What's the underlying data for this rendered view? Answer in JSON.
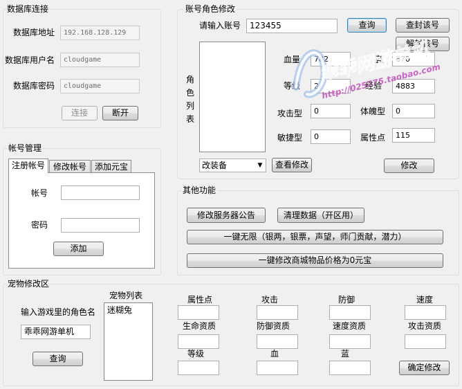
{
  "db": {
    "title": "数据库连接",
    "address_label": "数据库地址",
    "address_value": "192.168.128.129",
    "user_label": "数据库用户名",
    "user_value": "cloudgame",
    "password_label": "数据库密码",
    "password_value": "cloudgame",
    "connect_label": "连接",
    "disconnect_label": "断开"
  },
  "account": {
    "title": "帐号管理",
    "tabs": [
      "注册帐号",
      "修改帐号",
      "添加元宝"
    ],
    "account_label": "帐号",
    "password_label": "密码",
    "add_label": "添加"
  },
  "role": {
    "title": "账号角色修改",
    "input_label": "请输入账号",
    "input_value": "123455",
    "query_label": "查询",
    "ban_label": "查封该号",
    "unban_label": "解封该号",
    "list_label": "角色列表",
    "hp_label": "血量",
    "hp_value": "782",
    "mp_label": "蓝",
    "mp_value": "870",
    "level_label": "等级",
    "level_value": "2",
    "exp_label": "经验",
    "exp_value": "4883",
    "attack_label": "攻击型",
    "attack_value": "0",
    "physique_label": "体魄型",
    "physique_value": "0",
    "agility_label": "敏捷型",
    "agility_value": "0",
    "attr_label": "属性点",
    "attr_value": "115",
    "equip_select": "改装备",
    "view_label": "查看修改",
    "modify_label": "修改"
  },
  "other": {
    "title": "其他功能",
    "notice_label": "修改服务器公告",
    "clean_label": "清理数据（开区用）",
    "unlimited_label": "一键无限（银两，银票，声望，师门贡献，潜力）",
    "mall_label": "一键修改商城物品价格为0元宝"
  },
  "pet": {
    "title": "宠物修改区",
    "name_label": "输入游戏里的角色名",
    "name_value": "乖乖网游单机",
    "query_label": "查询",
    "list_label": "宠物列表",
    "list_items": [
      "迷糊兔"
    ],
    "fields": {
      "attr_point": "属性点",
      "attack": "攻击",
      "defense": "防御",
      "speed": "速度",
      "life_talent": "生命资质",
      "defense_talent": "防御资质",
      "speed_talent": "速度资质",
      "attack_talent": "攻击资质",
      "level": "等级",
      "hp": "血",
      "mp": "蓝"
    },
    "confirm_label": "确定修改"
  },
  "watermark": {
    "text": "乖乖网游单机",
    "url": "http://025775.taobao.com"
  }
}
